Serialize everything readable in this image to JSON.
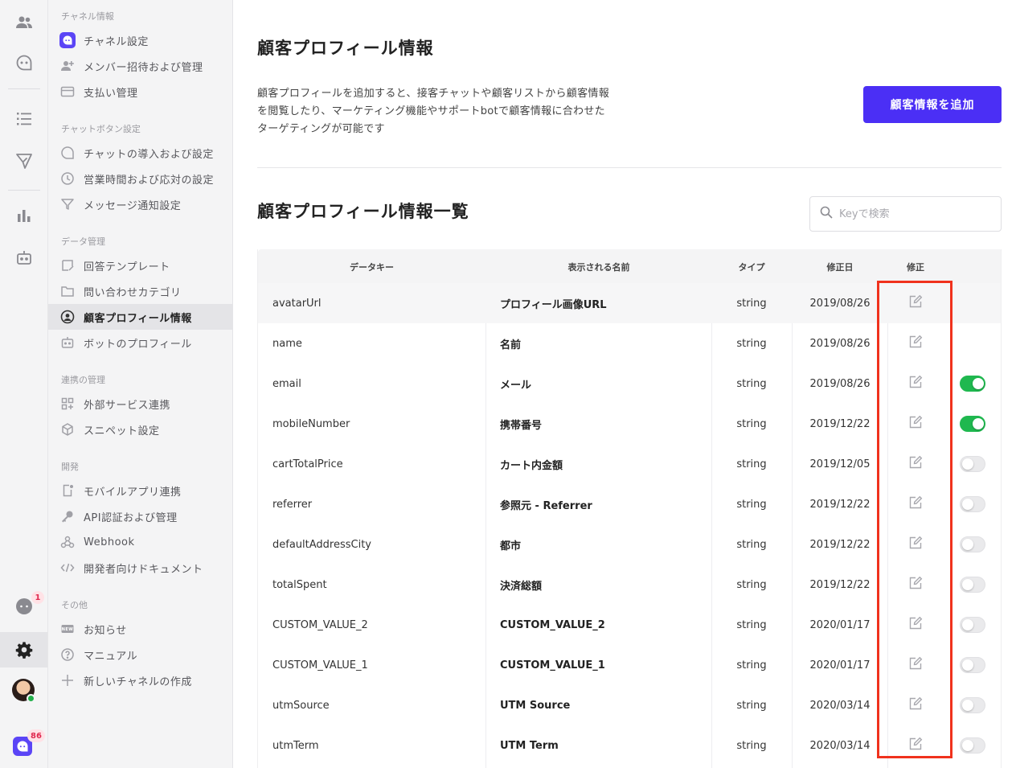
{
  "rail": {
    "items": [
      {
        "name": "users-icon"
      },
      {
        "name": "chat-icon"
      },
      {
        "name": "list-icon"
      },
      {
        "name": "send-icon"
      },
      {
        "name": "bar-chart-icon"
      },
      {
        "name": "bot-icon"
      }
    ],
    "notification_count": "1",
    "channel_badge": "86"
  },
  "nav": {
    "sections": [
      {
        "title": "チャネル情報",
        "items": [
          {
            "label": "チャネル設定",
            "icon": "channel-logo-icon"
          },
          {
            "label": "メンバー招待および管理",
            "icon": "add-member-icon"
          },
          {
            "label": "支払い管理",
            "icon": "credit-card-icon"
          }
        ]
      },
      {
        "title": "チャットボタン設定",
        "items": [
          {
            "label": "チャットの導入および設定",
            "icon": "chat-bubble-icon"
          },
          {
            "label": "営業時間および応対の設定",
            "icon": "clock-icon"
          },
          {
            "label": "メッセージ通知設定",
            "icon": "funnel-icon"
          }
        ]
      },
      {
        "title": "データ管理",
        "items": [
          {
            "label": "回答テンプレート",
            "icon": "template-icon"
          },
          {
            "label": "問い合わせカテゴリ",
            "icon": "folder-icon"
          },
          {
            "label": "顧客プロフィール情報",
            "icon": "user-circle-icon"
          },
          {
            "label": "ボットのプロフィール",
            "icon": "bot-icon"
          }
        ]
      },
      {
        "title": "連携の管理",
        "items": [
          {
            "label": "外部サービス連携",
            "icon": "apps-icon"
          },
          {
            "label": "スニペット設定",
            "icon": "cube-icon"
          }
        ]
      },
      {
        "title": "開発",
        "items": [
          {
            "label": "モバイルアプリ連携",
            "icon": "mobile-icon"
          },
          {
            "label": "API認証および管理",
            "icon": "key-icon"
          },
          {
            "label": "Webhook",
            "icon": "webhook-icon"
          },
          {
            "label": "開発者向けドキュメント",
            "icon": "code-icon"
          }
        ]
      },
      {
        "title": "その他",
        "items": [
          {
            "label": "お知らせ",
            "icon": "news-icon"
          },
          {
            "label": "マニュアル",
            "icon": "help-icon"
          },
          {
            "label": "新しいチャネルの作成",
            "icon": "plus-icon"
          }
        ]
      }
    ]
  },
  "main": {
    "title": "顧客プロフィール情報",
    "description_lines": [
      "顧客プロフィールを追加すると、接客チャットや顧客リストから顧客情報",
      "を閲覧したり、マーケティング機能やサポートbotで顧客情報に合わせた",
      "ターゲティングが可能です"
    ],
    "add_button": "顧客情報を追加",
    "list_title": "顧客プロフィール情報一覧",
    "search_placeholder": "Keyで検索",
    "columns": [
      "データキー",
      "表示される名前",
      "タイプ",
      "修正日",
      "修正"
    ],
    "rows": [
      {
        "key": "avatarUrl",
        "name": "プロフィール画像URL",
        "type": "string",
        "date": "2019/08/26",
        "toggle": null
      },
      {
        "key": "name",
        "name": "名前",
        "type": "string",
        "date": "2019/08/26",
        "toggle": null
      },
      {
        "key": "email",
        "name": "メール",
        "type": "string",
        "date": "2019/08/26",
        "toggle": true
      },
      {
        "key": "mobileNumber",
        "name": "携帯番号",
        "type": "string",
        "date": "2019/12/22",
        "toggle": true
      },
      {
        "key": "cartTotalPrice",
        "name": "カート内金額",
        "type": "string",
        "date": "2019/12/05",
        "toggle": false
      },
      {
        "key": "referrer",
        "name": "参照元 - Referrer",
        "type": "string",
        "date": "2019/12/22",
        "toggle": false
      },
      {
        "key": "defaultAddressCity",
        "name": "都市",
        "type": "string",
        "date": "2019/12/22",
        "toggle": false
      },
      {
        "key": "totalSpent",
        "name": "決済総額",
        "type": "string",
        "date": "2019/12/22",
        "toggle": false
      },
      {
        "key": "CUSTOM_VALUE_2",
        "name": "CUSTOM_VALUE_2",
        "type": "string",
        "date": "2020/01/17",
        "toggle": false
      },
      {
        "key": "CUSTOM_VALUE_1",
        "name": "CUSTOM_VALUE_1",
        "type": "string",
        "date": "2020/01/17",
        "toggle": false
      },
      {
        "key": "utmSource",
        "name": "UTM Source",
        "type": "string",
        "date": "2020/03/14",
        "toggle": false
      },
      {
        "key": "utmTerm",
        "name": "UTM Term",
        "type": "string",
        "date": "2020/03/14",
        "toggle": false
      }
    ]
  },
  "colors": {
    "accent": "#4b2ff5",
    "toggle_on": "#1fb84f",
    "highlight": "#f0321d"
  }
}
